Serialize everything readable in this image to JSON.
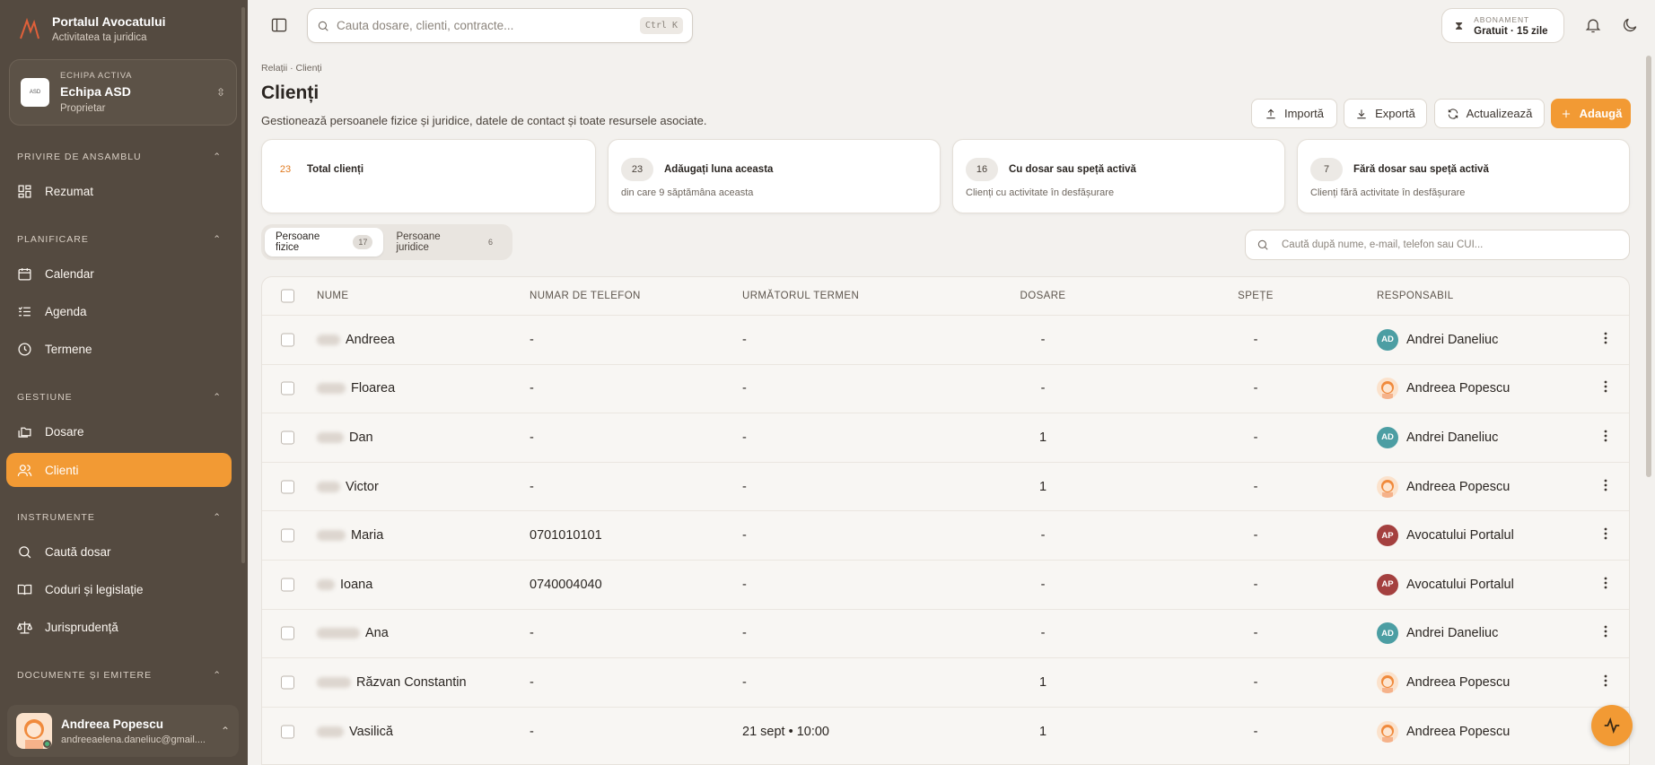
{
  "brand": {
    "title": "Portalul Avocatului",
    "subtitle": "Activitatea ta juridica"
  },
  "team": {
    "caption": "ECHIPA ACTIVA",
    "name": "Echipa ASD",
    "role": "Proprietar"
  },
  "sidebar": {
    "sections": [
      {
        "title": "PRIVIRE DE ANSAMBLU",
        "items": [
          {
            "label": "Rezumat",
            "icon": "grid-icon"
          }
        ]
      },
      {
        "title": "PLANIFICARE",
        "items": [
          {
            "label": "Calendar",
            "icon": "calendar-icon"
          },
          {
            "label": "Agenda",
            "icon": "list-icon"
          },
          {
            "label": "Termene",
            "icon": "clock-icon"
          }
        ]
      },
      {
        "title": "GESTIUNE",
        "items": [
          {
            "label": "Dosare",
            "icon": "folders-icon"
          },
          {
            "label": "Clienti",
            "icon": "users-icon",
            "active": true
          }
        ]
      },
      {
        "title": "INSTRUMENTE",
        "items": [
          {
            "label": "Caută dosar",
            "icon": "search-icon"
          },
          {
            "label": "Coduri și legislație",
            "icon": "book-icon"
          },
          {
            "label": "Jurisprudență",
            "icon": "scale-icon"
          }
        ]
      },
      {
        "title": "DOCUMENTE ȘI EMITERE",
        "items": []
      }
    ]
  },
  "user": {
    "name": "Andreea Popescu",
    "email": "andreeaelena.daneliuc@gmail...."
  },
  "topbar": {
    "search_placeholder": "Cauta dosare, clienti, contracte...",
    "shortcut": "Ctrl K",
    "subscription_caption": "ABONAMENT",
    "subscription_value": "Gratuit · 15 zile"
  },
  "page": {
    "breadcrumb": "Relații · Clienți",
    "title": "Clienți",
    "subtitle": "Gestionează persoanele fizice și juridice, datele de contact și toate resursele asociate."
  },
  "actions": {
    "import": "Importă",
    "export": "Exportă",
    "refresh": "Actualizează",
    "add": "Adaugă"
  },
  "stats": [
    {
      "value": "23",
      "label": "Total clienți",
      "sub": ""
    },
    {
      "value": "23",
      "label": "Adăugați luna aceasta",
      "sub": "din care 9 săptămâna aceasta"
    },
    {
      "value": "16",
      "label": "Cu dosar sau speță activă",
      "sub": "Clienți cu activitate în desfășurare"
    },
    {
      "value": "7",
      "label": "Fără dosar sau speță activă",
      "sub": "Clienți fără activitate în desfășurare"
    }
  ],
  "tabs": [
    {
      "label": "Persoane fizice",
      "count": "17",
      "active": true
    },
    {
      "label": "Persoane juridice",
      "count": "6"
    }
  ],
  "table_search_placeholder": "Caută după nume, e-mail, telefon sau CUI...",
  "table": {
    "columns": [
      "NUME",
      "NUMAR DE TELEFON",
      "URMĂTORUL TERMEN",
      "DOSARE",
      "SPEȚE",
      "RESPONSABIL"
    ],
    "rows": [
      {
        "name": "Andreea",
        "phone": "-",
        "term": "-",
        "dosare": "-",
        "spete": "-",
        "resp": "Andrei Daneliuc",
        "initials": "AD",
        "avatar": "ad"
      },
      {
        "name": "Floarea",
        "phone": "-",
        "term": "-",
        "dosare": "-",
        "spete": "-",
        "resp": "Andreea Popescu",
        "initials": "",
        "avatar": "img"
      },
      {
        "name": "Dan",
        "phone": "-",
        "term": "-",
        "dosare": "1",
        "spete": "-",
        "resp": "Andrei Daneliuc",
        "initials": "AD",
        "avatar": "ad"
      },
      {
        "name": "Victor",
        "phone": "-",
        "term": "-",
        "dosare": "1",
        "spete": "-",
        "resp": "Andreea Popescu",
        "initials": "",
        "avatar": "img"
      },
      {
        "name": "Maria",
        "phone": "0701010101",
        "term": "-",
        "dosare": "-",
        "spete": "-",
        "resp": "Avocatului Portalul",
        "initials": "AP",
        "avatar": "ap"
      },
      {
        "name": "Ioana",
        "phone": "0740004040",
        "term": "-",
        "dosare": "-",
        "spete": "-",
        "resp": "Avocatului Portalul",
        "initials": "AP",
        "avatar": "ap"
      },
      {
        "name": "Ana",
        "phone": "-",
        "term": "-",
        "dosare": "-",
        "spete": "-",
        "resp": "Andrei Daneliuc",
        "initials": "AD",
        "avatar": "ad"
      },
      {
        "name": "Răzvan Constantin",
        "phone": "-",
        "term": "-",
        "dosare": "1",
        "spete": "-",
        "resp": "Andreea Popescu",
        "initials": "",
        "avatar": "img"
      },
      {
        "name": "Vasilică",
        "phone": "-",
        "term": "21 sept • 10:00",
        "dosare": "1",
        "spete": "-",
        "resp": "Andreea Popescu",
        "initials": "",
        "avatar": "img"
      }
    ]
  },
  "colors": {
    "accent": "#f29a34",
    "sidebar_bg": "#544a40",
    "avatar_ad": "#4c9ea3",
    "avatar_ap": "#a4403f"
  }
}
